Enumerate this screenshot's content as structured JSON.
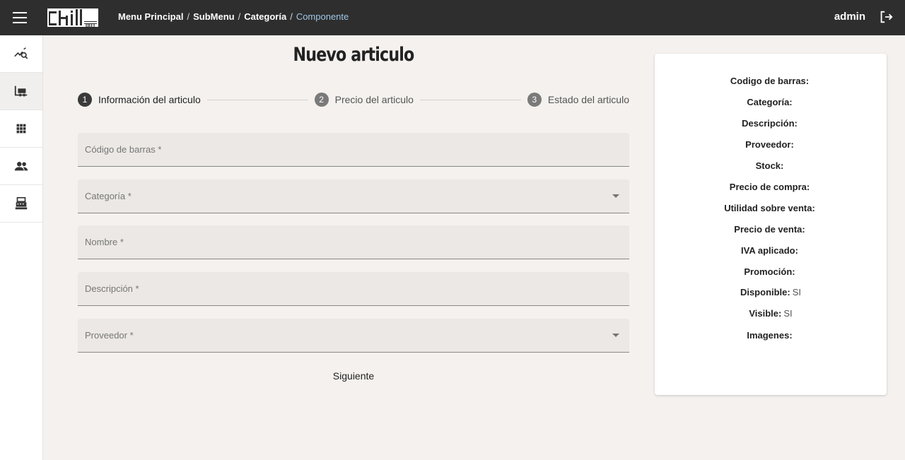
{
  "header": {
    "breadcrumb": [
      "Menu Principal",
      "SubMenu",
      "Categoría"
    ],
    "breadcrumb_sep": "/",
    "breadcrumb_current": "Componente",
    "user": "admin"
  },
  "sidebar": {
    "items": [
      {
        "icon": "analytics-search-icon",
        "active": false
      },
      {
        "icon": "store-icon",
        "active": true
      },
      {
        "icon": "grid-icon",
        "active": false
      },
      {
        "icon": "people-icon",
        "active": false
      },
      {
        "icon": "cash-register-icon",
        "active": false
      }
    ]
  },
  "main": {
    "title": "Nuevo articulo",
    "steps": [
      {
        "num": "1",
        "label": "Información del articulo"
      },
      {
        "num": "2",
        "label": "Precio del articulo"
      },
      {
        "num": "3",
        "label": "Estado del articulo"
      }
    ],
    "fields": [
      {
        "label": "Código de barras *",
        "value": "",
        "type": "text"
      },
      {
        "label": "Categoría *",
        "value": "",
        "type": "select"
      },
      {
        "label": "Nombre *",
        "value": "",
        "type": "text"
      },
      {
        "label": "Descripción *",
        "value": "",
        "type": "text"
      },
      {
        "label": "Proveedor *",
        "value": "",
        "type": "select"
      }
    ],
    "next_label": "Siguiente"
  },
  "summary": {
    "rows": [
      {
        "key": "Codigo de barras:",
        "value": ""
      },
      {
        "key": "Categoría:",
        "value": ""
      },
      {
        "key": "Descripción:",
        "value": ""
      },
      {
        "key": "Proveedor:",
        "value": ""
      },
      {
        "key": "Stock:",
        "value": ""
      },
      {
        "key": "Precio de compra:",
        "value": ""
      },
      {
        "key": "Utilidad sobre venta:",
        "value": ""
      },
      {
        "key": "Precio de venta:",
        "value": ""
      },
      {
        "key": "IVA aplicado:",
        "value": ""
      },
      {
        "key": "Promoción:",
        "value": ""
      },
      {
        "key": "Disponible:",
        "value": "SI"
      },
      {
        "key": "Visible:",
        "value": "SI"
      },
      {
        "key": "Imagenes:",
        "value": ""
      }
    ]
  },
  "colors": {
    "topbar": "#2e2e2e",
    "page_bg": "#f4f1ee",
    "field_bg": "#ebe8e5",
    "breadcrumb_current": "#9ec6e6"
  }
}
